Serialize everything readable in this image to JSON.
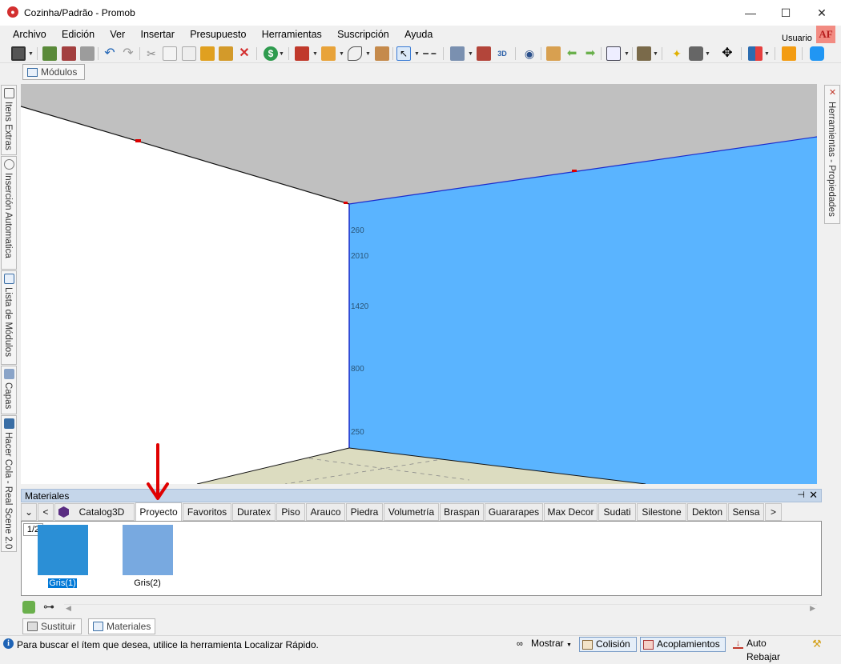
{
  "window": {
    "title": "Cozinha/Padrão - Promob",
    "controls": {
      "minimize": "—",
      "maximize": "☐",
      "close": "✕"
    }
  },
  "menu": [
    "Archivo",
    "Edición",
    "Ver",
    "Insertar",
    "Presupuesto",
    "Herramientas",
    "Suscripción",
    "Ayuda"
  ],
  "user": {
    "label": "Usuario",
    "initials": "AF"
  },
  "modulos_tab": "Módulos",
  "left_dock": [
    "Itens Extras",
    "Inserción Automatica",
    "Lista de Módulos",
    "Capas",
    "Hacer Cola - Real Scene 2.0"
  ],
  "right_dock": [
    "Herramientas - Propiedades"
  ],
  "viewport": {
    "dimension_labels": [
      "260",
      "2010",
      "1420",
      "800",
      "250"
    ],
    "wall_color": "#5ab4ff",
    "ceiling_color": "#c0c0c0",
    "floor_color": "#dcdcc0"
  },
  "materials": {
    "title": "Materiales",
    "pin_icon": "⊣",
    "close_icon": "✕",
    "dropdown_icon": "⌄",
    "prev_icon": "<",
    "next_icon": ">",
    "tabs": [
      "Catalog3D",
      "Proyecto",
      "Favoritos",
      "Duratex",
      "Piso",
      "Arauco",
      "Piedra",
      "Volumetría",
      "Braspan",
      "Guararapes",
      "Max Decor",
      "Sudati",
      "Silestone",
      "Dekton",
      "Sensa"
    ],
    "active_tab": "Proyecto",
    "page_indicator": "1/2",
    "swatches": [
      {
        "label": "Gris(1)",
        "color": "#2b8fd6",
        "selected": true
      },
      {
        "label": "Gris(2)",
        "color": "#78a9e0",
        "selected": false
      }
    ]
  },
  "bottom_tabs": [
    "Sustituir",
    "Materiales"
  ],
  "status": {
    "info_icon": "i",
    "text": "Para buscar el ítem que desea, utilice la herramienta Localizar Rápido.",
    "mostrar": "Mostrar",
    "colision": "Colisión",
    "acoplamientos": "Acoplamientos",
    "auto_rebajar": "Auto Rebajar"
  },
  "colors": {
    "accent": "#0078d7",
    "annotation_arrow": "#e00000"
  }
}
